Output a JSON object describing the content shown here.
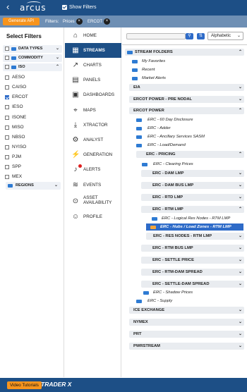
{
  "topbar": {
    "logo_text": "arcus",
    "show_filters_label": "Show Filters",
    "show_filters_checked": true
  },
  "filterbar": {
    "generate_api_label": "Generate API",
    "filters_label": "Filters:",
    "chips": [
      {
        "label": "Prices"
      },
      {
        "label": "ERCOT"
      }
    ]
  },
  "left_panel": {
    "title": "Select Filters",
    "groups": [
      {
        "label": "DATA TYPES",
        "expanded": false
      },
      {
        "label": "COMMODITY",
        "expanded": false
      },
      {
        "label": "ISO",
        "expanded": true
      }
    ],
    "iso_items": [
      {
        "label": "AESO",
        "checked": false
      },
      {
        "label": "CAISO",
        "checked": false
      },
      {
        "label": "ERCOT",
        "checked": true
      },
      {
        "label": "IESO",
        "checked": false
      },
      {
        "label": "ISONE",
        "checked": false
      },
      {
        "label": "MISO",
        "checked": false
      },
      {
        "label": "NBSO",
        "checked": false
      },
      {
        "label": "NYISO",
        "checked": false
      },
      {
        "label": "PJM",
        "checked": false
      },
      {
        "label": "SPP",
        "checked": false
      },
      {
        "label": "MEX",
        "checked": false
      }
    ],
    "regions_label": "REGIONS"
  },
  "nav": {
    "items": [
      {
        "label": "HOME",
        "icon": "home-icon"
      },
      {
        "label": "STREAMS",
        "icon": "streams-icon",
        "active": true
      },
      {
        "label": "CHARTS",
        "icon": "charts-icon"
      },
      {
        "label": "PANELS",
        "icon": "panels-icon"
      },
      {
        "label": "DASHBOARDS",
        "icon": "dashboards-icon"
      },
      {
        "label": "MAPS",
        "icon": "maps-icon"
      },
      {
        "label": "XTRACTOR",
        "icon": "xtractor-icon"
      },
      {
        "label": "ANALYST",
        "icon": "analyst-icon"
      },
      {
        "label": "GENERATION",
        "icon": "generation-icon"
      },
      {
        "label": "ALERTS",
        "icon": "alerts-icon"
      },
      {
        "label": "EVENTS",
        "icon": "events-icon"
      },
      {
        "label_line1": "ASSET",
        "label_line2": "AVAILABILITY",
        "icon": "asset-availability-icon"
      },
      {
        "label": "PROFILE",
        "icon": "profile-icon"
      }
    ]
  },
  "streams": {
    "search_placeholder": "",
    "sort_value": "Alphabetic",
    "root": "STREAM FOLDERS",
    "top_links": [
      "My Favorites",
      "Recent",
      "Market Alerts"
    ],
    "folders": {
      "eia": "EIA",
      "ercot_pre_nodal": "ERCOT POWER - PRE NODAL",
      "ercot_power": "ERCOT POWER",
      "erc_60_day": "ERC - 60 Day Disclosure",
      "erc_adder": "ERC - Adder",
      "erc_ancillary": "ERC - Ancillary Services SASM",
      "erc_load_demand": "ERC - Load/Demand",
      "erc_pricing": "ERC - PRICING",
      "erc_clearing_prices": "ERC - Clearing Prices",
      "erc_dam_lmp": "ERC - DAM LMP",
      "erc_dam_bus_lmp": "ERC - DAM BUS LMP",
      "erc_rtd_lmp": "ERC - RTD LMP",
      "erc_rtm_lmp": "ERC - RTM LMP",
      "erc_logical_res": "ERC - Logical Res Nodes - RTM LMP",
      "erc_hubs_load": "ERC - Hubs / Load Zones - RTM LMP",
      "erc_res_nodes": "ERC - RES NODES - RTM LMP",
      "erc_rtm_bus_lmp": "ERC - RTM BUS LMP",
      "erc_settle_price": "ERC - SETTLE PRICE",
      "erc_rtm_dam_spread": "ERC - RTM-DAM SPREAD",
      "erc_settle_dam_spread": "ERC - SETTLE-DAM SPREAD",
      "erc_shadow_prices": "ERC - Shadow Prices",
      "erc_supply": "ERC - Supply",
      "ice_exchange": "ICE EXCHANGE",
      "nymex": "NYMEX",
      "prt": "PRT",
      "pwrstream": "PWRSTREAM"
    }
  },
  "bottombar": {
    "video_tutorials_label": "Video Tutorials",
    "brand": "TRADER X"
  },
  "colors": {
    "navy": "#1d4f86",
    "orange": "#f7941d",
    "accent_blue": "#2e6bc8"
  }
}
